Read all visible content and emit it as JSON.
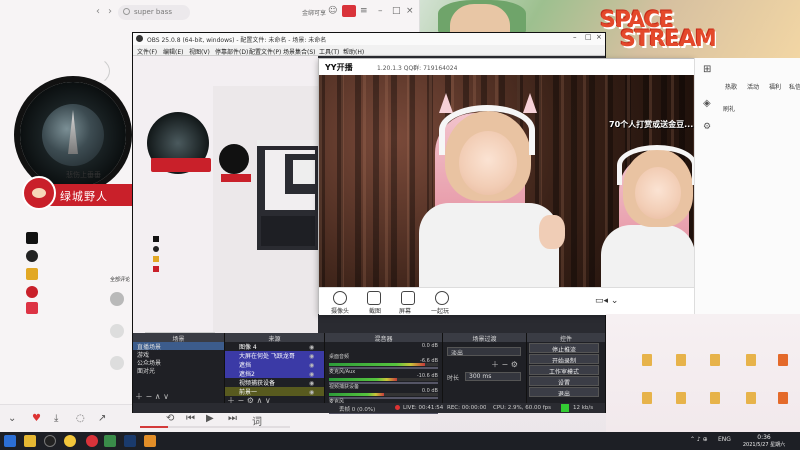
{
  "music": {
    "search_placeholder": "super bass",
    "top_right": "金绑可享",
    "badge_text": "绿城野人",
    "badge_small": "悲伤上垂垂",
    "social": [
      "",
      "",
      "",
      "",
      ""
    ],
    "vip_tag": "全部评论"
  },
  "obs": {
    "title": "OBS 25.0.8 (64-bit, windows) - 配置文件: 未命名 - 场景: 未命名",
    "menu": [
      "文件(F)",
      "编辑(E)",
      "视图(V)",
      "停靠部件(D)",
      "配置文件(P)",
      "场景集合(S)",
      "工具(T)",
      "帮助(H)"
    ],
    "docks": {
      "scenes": "场景",
      "sources": "来源",
      "mixer": "混音器",
      "transitions": "场景过渡",
      "controls": "控件"
    },
    "scenes": [
      "直播场景",
      "游戏",
      "公众场景",
      "面对光"
    ],
    "sources": [
      "图像 4",
      "大屏在何处 飞跃龙哥",
      "遮挡",
      "遮挡2",
      "视频捕获设备",
      "前景一"
    ],
    "mixer": [
      {
        "name": "桌面音频",
        "db": "0.0 dB",
        "level": 0.88
      },
      {
        "name": "麦克风/Aux",
        "db": "-6.6 dB",
        "level": 0.62
      },
      {
        "name": "视频捕获设备",
        "db": "-10.6 dB",
        "level": 0.5
      },
      {
        "name": "麦克风",
        "db": "0.0 dB",
        "level": 0.3
      }
    ],
    "transition": {
      "type": "淡出",
      "duration_label": "时长",
      "duration": "300 ms"
    },
    "controls": [
      "停止推流",
      "开始录制",
      "工作室模式",
      "设置",
      "退出"
    ],
    "status": {
      "dropped": "丢帧 0 (0.0%)",
      "live": "LIVE: 00:41:54",
      "rec": "REC: 00:00:00",
      "cpu": "CPU: 2.9%, 60.00 fps",
      "kbps": "12 kb/s"
    }
  },
  "yy": {
    "title": "YY开播",
    "version": "1.20.1.3  QQ群: 719164024",
    "marquee": "70个人打赏或送金豆... ",
    "buttons": [
      "摄像头",
      "截图",
      "屏幕",
      "一起玩"
    ],
    "right_tabs": [
      "热歌",
      "活动",
      "福利",
      "私信"
    ],
    "right_item": "刷礼"
  },
  "wall": {
    "logo_line1": "SPACE",
    "logo_line2": "STREAM"
  },
  "desktop": {
    "icons": [
      "",
      "",
      "",
      "",
      "",
      "",
      "",
      "",
      "",
      ""
    ]
  },
  "taskbar": {
    "lang": "ENG",
    "time": "0:36",
    "date": "2021/5/27 星期六"
  }
}
